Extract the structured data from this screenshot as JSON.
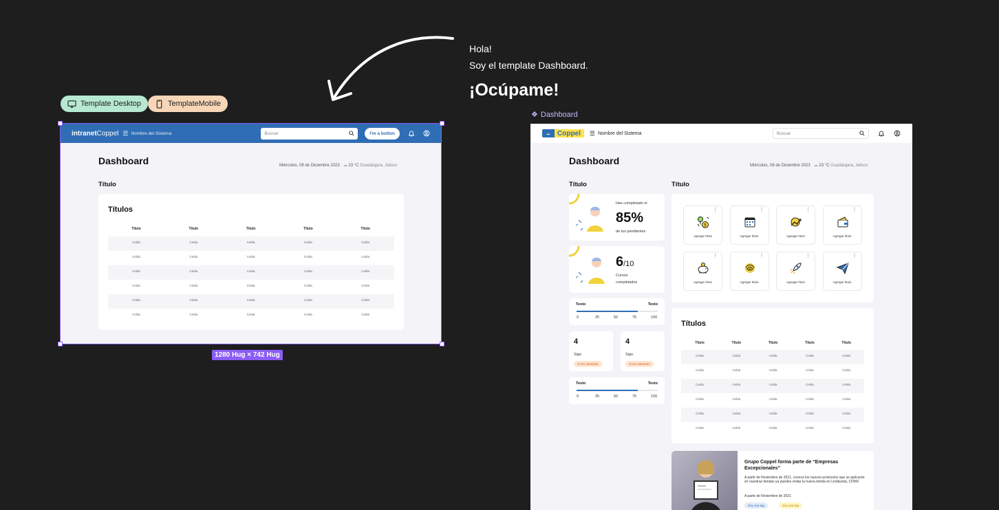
{
  "intro": {
    "line1": "Hola!",
    "line2": "Soy el template Dashboard.",
    "headline": "¡Ocúpame!"
  },
  "pills": {
    "desktop": "Template Desktop",
    "mobile": "TemplateMobile"
  },
  "frame_badge": "1280 Hug × 742 Hug",
  "desktop": {
    "logo_bold": "intranet",
    "logo_rest": "Coppel",
    "system_name": "Nombre del Sistema",
    "search_placeholder": "Buscar",
    "button_label": "I'm a button",
    "page_title": "Dashboard",
    "date": "Miércoles, 08 de Diciembre 2023",
    "weather": "23 °C",
    "location": "Guadalajara, Jalisco",
    "section_title": "Título",
    "table_title": "Títulos",
    "columns": [
      "Título",
      "Título",
      "Título",
      "Título",
      "Título"
    ],
    "rows": [
      [
        "Celda",
        "Celda",
        "Celda",
        "Celda",
        "Celda"
      ],
      [
        "Celda",
        "Celda",
        "Celda",
        "Celda",
        "Celda"
      ],
      [
        "Celda",
        "Celda",
        "Celda",
        "Celda",
        "Celda"
      ],
      [
        "Celda",
        "Celda",
        "Celda",
        "Celda",
        "Celda"
      ],
      [
        "Celda",
        "Celda",
        "Celda",
        "Celda",
        "Celda"
      ],
      [
        "Celda",
        "Celda",
        "Celda",
        "Celda",
        "Celda"
      ]
    ]
  },
  "mobile": {
    "frame_label": "Dashboard",
    "logo_text": "Coppel",
    "system_name": "Nombre del Sistema",
    "search_placeholder": "Buscar",
    "page_title": "Dashboard",
    "date": "Miércoles, 08 de Diciembre 2023",
    "weather": "23 °C",
    "location": "Guadalajara, Jalisco",
    "left_title": "Título",
    "right_title": "Título",
    "progress_card": {
      "caption_top": "Has completado el",
      "value": "85%",
      "caption_bottom": "de tus pendientes"
    },
    "courses_card": {
      "value": "6",
      "total": "/10",
      "caption1": "Cursos",
      "caption2": "completados"
    },
    "slider1": {
      "label_left": "Texto",
      "label_right": "Texto",
      "ticks": [
        "0",
        "25",
        "50",
        "75",
        "100"
      ],
      "value": 75
    },
    "stat_cards": [
      {
        "value": "4",
        "label": "Sigo",
        "tag": "Curso atrasado"
      },
      {
        "value": "4",
        "label": "Sigo",
        "tag": "Curso atrasado"
      }
    ],
    "slider2": {
      "label_left": "Texto",
      "label_right": "Texto",
      "ticks": [
        "0",
        "25",
        "50",
        "75",
        "100"
      ],
      "value": 75
    },
    "tiles": [
      {
        "label": "Agregar título",
        "icon": "balloon-money-icon"
      },
      {
        "label": "Agregar título",
        "icon": "calendar-icon"
      },
      {
        "label": "Agregar título",
        "icon": "trend-chart-icon"
      },
      {
        "label": "Agregar título",
        "icon": "wallet-icon"
      },
      {
        "label": "Agregar título",
        "icon": "piggy-bank-icon"
      },
      {
        "label": "Agregar título",
        "icon": "fingerprint-icon"
      },
      {
        "label": "Agregar título",
        "icon": "rocket-icon"
      },
      {
        "label": "Agregar título",
        "icon": "paper-plane-icon"
      }
    ],
    "table_title": "Títulos",
    "columns": [
      "Título",
      "Título",
      "Título",
      "Título",
      "Título"
    ],
    "rows": [
      [
        "Celda",
        "Celda",
        "Celda",
        "Celda",
        "Celda"
      ],
      [
        "Celda",
        "Celda",
        "Celda",
        "Celda",
        "Celda"
      ],
      [
        "Celda",
        "Celda",
        "Celda",
        "Celda",
        "Celda"
      ],
      [
        "Celda",
        "Celda",
        "Celda",
        "Celda",
        "Celda"
      ],
      [
        "Celda",
        "Celda",
        "Celda",
        "Celda",
        "Celda"
      ],
      [
        "Celda",
        "Celda",
        "Celda",
        "Celda",
        "Celda"
      ]
    ],
    "news": {
      "title": "Grupo Coppel forma parte de “Empresas Excepcionales”",
      "body": "A partir de Noviembre de 2021, conoce los nuevos protocolos que se aplicarán en nuestras tiendas ya puedes visitar la nueva tienda en Lindavista, CDMX",
      "date": "A partir de Noviembre de 2021",
      "tag1": "Soy una tag",
      "tag2": "Soy una tag"
    }
  },
  "colors": {
    "brand_blue": "#2f6db5",
    "coppel_yellow": "#ffe14d",
    "selection_purple": "#8b5cf6",
    "tag_orange": "#fde4d0"
  }
}
